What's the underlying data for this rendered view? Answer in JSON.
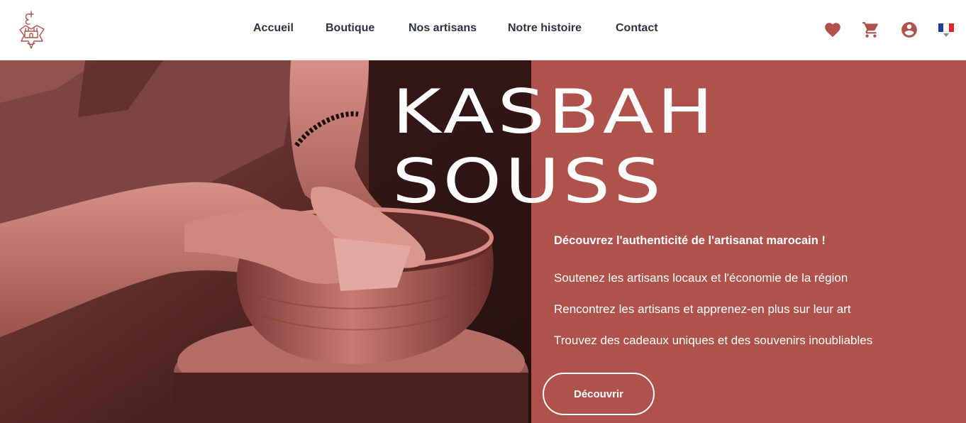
{
  "header": {
    "nav": [
      "Accueil",
      "Boutique",
      "Nos artisans",
      "Notre histoire",
      "Contact"
    ],
    "icons": [
      "heart-icon",
      "cart-icon",
      "account-icon",
      "flag-fr-icon"
    ],
    "brand_color": "#b0524c"
  },
  "hero": {
    "title_line1": "KASBAH",
    "title_line2": "SOUSS",
    "tagline": "Découvrez l'authenticité de l'artisanat marocain !",
    "benefits": [
      "Soutenez les artisans locaux et l'économie de la région",
      "Rencontrez les artisans et apprenez-en plus sur leur art",
      "Trouvez des cadeaux uniques et des souvenirs inoubliables"
    ],
    "cta_label": "Découvrir",
    "panel_color": "#b0524c"
  }
}
